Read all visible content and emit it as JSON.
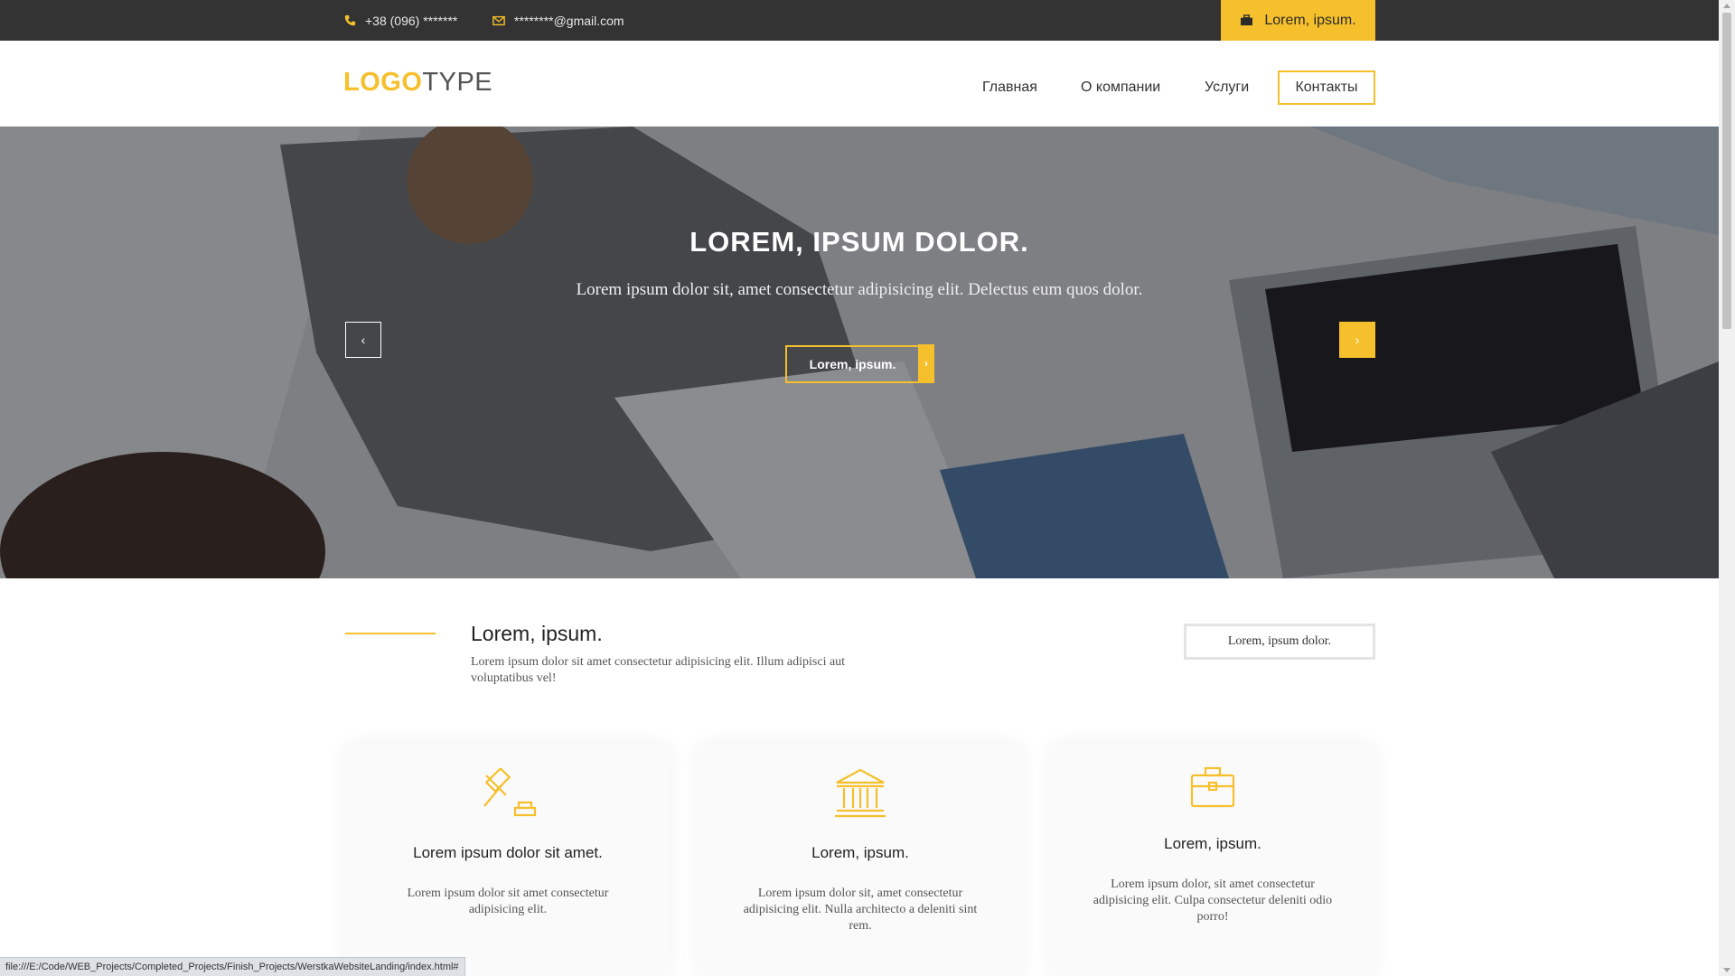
{
  "topbar": {
    "phone": "+38 (096) *******",
    "email": "********@gmail.com",
    "button_label": "Lorem, ipsum.",
    "icons": [
      "phone-icon",
      "mail-icon",
      "briefcase-icon"
    ]
  },
  "header": {
    "logo_part1": "LOGO",
    "logo_part2": "TYPE",
    "nav": [
      "Главная",
      "О компании",
      "Услуги",
      "Контакты"
    ],
    "active_nav": "Контакты"
  },
  "hero": {
    "title": "LOREM, IPSUM DOLOR.",
    "subtitle": "Lorem ipsum dolor sit, amet consectetur adipisicing elit. Delectus eum quos dolor.",
    "button_label": "Lorem, ipsum.",
    "prev_arrow": "‹",
    "next_arrow": "›",
    "button_arrow": "›"
  },
  "intro": {
    "title": "Lorem, ipsum.",
    "text": "Lorem ipsum dolor sit amet consectetur adipisicing elit. Illum adipisci aut voluptatibus vel!",
    "button_label": "Lorem, ipsum dolor."
  },
  "cards": [
    {
      "icon": "gavel-icon",
      "title": "Lorem ipsum dolor sit amet.",
      "text": "Lorem ipsum dolor sit amet consectetur adipisicing elit."
    },
    {
      "icon": "bank-icon",
      "title": "Lorem, ipsum.",
      "text": "Lorem ipsum dolor sit, amet consectetur adipisicing elit. Nulla architecto a deleniti sint rem."
    },
    {
      "icon": "briefcase-icon",
      "title": "Lorem, ipsum.",
      "text": "Lorem ipsum dolor, sit amet consectetur adipisicing elit. Culpa consectetur deleniti odio porro!"
    }
  ],
  "statusbar": {
    "url": "file:///E:/Code/WEB_Projects/Completed_Projects/Finish_Projects/WerstkaWebsiteLanding/index.html#"
  },
  "colors": {
    "accent": "#f5c02b",
    "topbar_bg": "#333333"
  }
}
